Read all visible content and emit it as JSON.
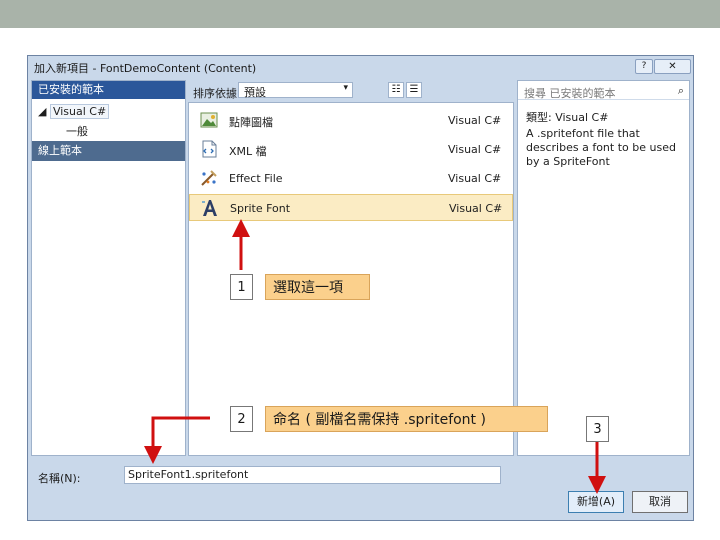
{
  "window": {
    "title": "加入新項目 - FontDemoContent (Content)",
    "help_label": "?",
    "close_label": "✕"
  },
  "left_panel": {
    "header": "已安裝的範本",
    "tree_lang": "Visual C#",
    "tree_child": "一般",
    "online": "線上範本"
  },
  "toolbar": {
    "sort_label": "排序依據:",
    "sort_value": "預設",
    "sort_arrow": "▾",
    "view_small": "☷",
    "view_list": "☰"
  },
  "templates": [
    {
      "name": "點陣圖檔",
      "type": "Visual C#",
      "icon": "bitmap-icon",
      "selected": false
    },
    {
      "name": "XML 檔",
      "type": "Visual C#",
      "icon": "xml-file-icon",
      "selected": false
    },
    {
      "name": "Effect File",
      "type": "Visual C#",
      "icon": "effect-file-icon",
      "selected": false
    },
    {
      "name": "Sprite Font",
      "type": "Visual C#",
      "icon": "sprite-font-icon",
      "selected": true
    }
  ],
  "search": {
    "placeholder": "搜尋 已安裝的範本",
    "icon": "search-icon"
  },
  "description": {
    "type_line": "類型: Visual C#",
    "text": "A .spritefont file that describes a font to be used by a SpriteFont"
  },
  "name_field": {
    "label": "名稱(N):",
    "value": "SpriteFont1.spritefont"
  },
  "buttons": {
    "add": "新增(A)",
    "cancel": "取消"
  },
  "annotations": {
    "step1_number": "1",
    "step1_text": "選取這一項",
    "step2_number": "2",
    "step2_text": "命名 ( 副檔名需保持 .spritefont )",
    "step3_number": "3",
    "arrow_color": "#d01010",
    "box_color": "#fbd08c"
  },
  "colors": {
    "top_bar": "#a9b3a9",
    "window_frame": "#c9d8ea",
    "panel_header": "#2b579a",
    "selected_row": "#fbecc4"
  }
}
